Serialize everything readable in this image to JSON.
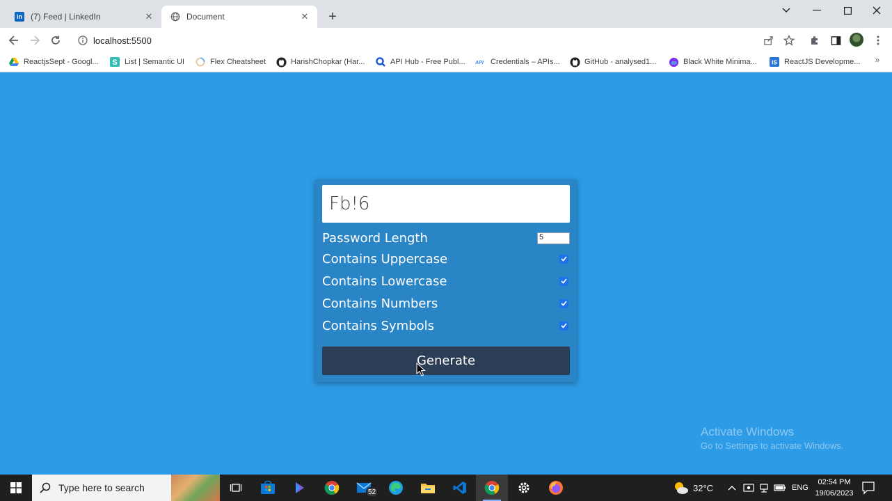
{
  "browser": {
    "tabs": [
      {
        "title": "(7) Feed | LinkedIn",
        "favicon": "linkedin-icon",
        "active": false
      },
      {
        "title": "Document",
        "favicon": "globe-icon",
        "active": true
      }
    ],
    "tab_close_glyph": "✕",
    "new_tab_glyph": "+",
    "url": "localhost:5500",
    "bookmarks": [
      {
        "label": "ReactjsSept - Googl...",
        "icon": "google-drive-icon"
      },
      {
        "label": "List | Semantic UI",
        "icon": "semantic-ui-icon"
      },
      {
        "label": "Flex Cheatsheet",
        "icon": "flex-icon"
      },
      {
        "label": "HarishChopkar (Har...",
        "icon": "github-icon"
      },
      {
        "label": "API Hub - Free Publ...",
        "icon": "api-hub-icon"
      },
      {
        "label": "Credentials – APIs...",
        "icon": "api-icon"
      },
      {
        "label": "GitHub - analysed1...",
        "icon": "github-icon"
      },
      {
        "label": "Black White Minima...",
        "icon": "canva-icon"
      },
      {
        "label": "ReactJS Developme...",
        "icon": "is-icon"
      }
    ],
    "bookmarks_more_glyph": "»"
  },
  "app": {
    "password": "Fb!6",
    "length_label": "Password Length",
    "length_value": "5",
    "options": [
      {
        "label": "Contains Uppercase",
        "checked": true
      },
      {
        "label": "Contains Lowercase",
        "checked": true
      },
      {
        "label": "Contains Numbers",
        "checked": true
      },
      {
        "label": "Contains Symbols",
        "checked": true
      }
    ],
    "generate_label": "Generate"
  },
  "watermark": {
    "line1": "Activate Windows",
    "line2": "Go to Settings to activate Windows."
  },
  "taskbar": {
    "search_placeholder": "Type here to search",
    "mail_badge": "52",
    "weather_temp": "32°C",
    "language": "ENG",
    "time": "02:54 PM",
    "date": "19/06/2023"
  },
  "colors": {
    "page_bg": "#2e9be6",
    "card_bg": "#2985c6",
    "button_bg": "#2c3e56",
    "checkbox": "#1a73e8"
  }
}
